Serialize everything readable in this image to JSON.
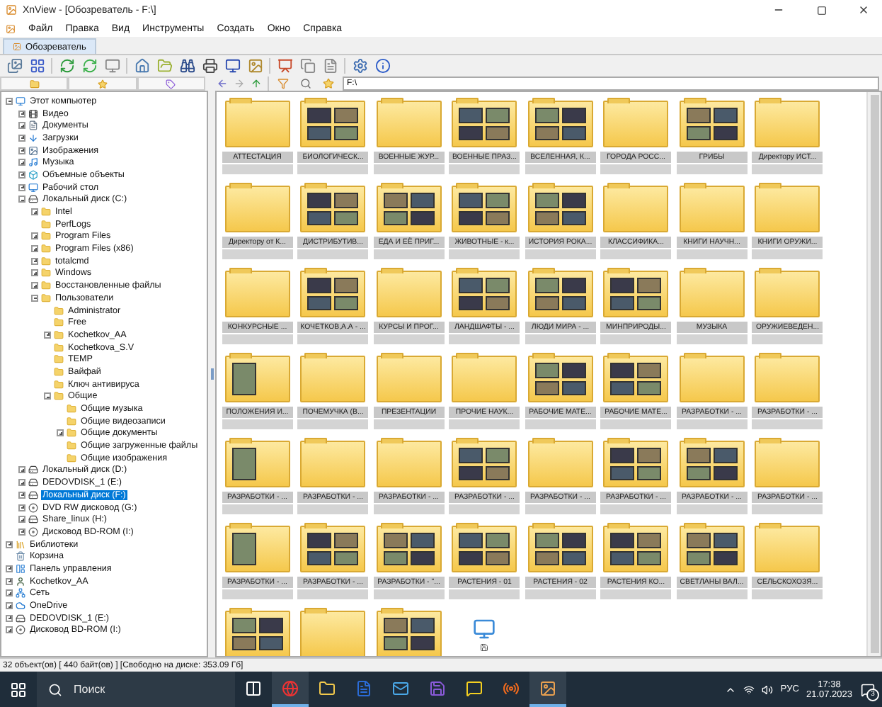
{
  "window": {
    "title": "XnView - [Обозреватель - F:\\]"
  },
  "menu": [
    "Файл",
    "Правка",
    "Вид",
    "Инструменты",
    "Создать",
    "Окно",
    "Справка"
  ],
  "tabs": [
    {
      "label": "Обозреватель",
      "selected": true
    }
  ],
  "path": {
    "value": "F:\\"
  },
  "tree": [
    {
      "label": "Этот компьютер",
      "kind": "computer",
      "expanded": true,
      "selected": false,
      "children": [
        {
          "label": "Видео",
          "kind": "video",
          "expanded": false,
          "selected": false
        },
        {
          "label": "Документы",
          "kind": "documents",
          "expanded": false,
          "selected": false
        },
        {
          "label": "Загрузки",
          "kind": "downloads",
          "expanded": false,
          "selected": false
        },
        {
          "label": "Изображения",
          "kind": "pictures",
          "expanded": false,
          "selected": false
        },
        {
          "label": "Музыка",
          "kind": "music",
          "expanded": false,
          "selected": false
        },
        {
          "label": "Объемные объекты",
          "kind": "objects",
          "expanded": false,
          "selected": false
        },
        {
          "label": "Рабочий стол",
          "kind": "desktop",
          "expanded": false,
          "selected": false
        },
        {
          "label": "Локальный диск (C:)",
          "kind": "drive",
          "expanded": true,
          "selected": false,
          "children": [
            {
              "label": "Intel",
              "kind": "folder",
              "expanded": false,
              "selected": false
            },
            {
              "label": "PerfLogs",
              "kind": "folder",
              "selected": false
            },
            {
              "label": "Program Files",
              "kind": "folder",
              "expanded": false,
              "selected": false
            },
            {
              "label": "Program Files (x86)",
              "kind": "folder",
              "expanded": false,
              "selected": false
            },
            {
              "label": "totalcmd",
              "kind": "folder",
              "expanded": false,
              "selected": false
            },
            {
              "label": "Windows",
              "kind": "folder",
              "expanded": false,
              "selected": false
            },
            {
              "label": "Восстановленные файлы",
              "kind": "folder",
              "expanded": false,
              "selected": false
            },
            {
              "label": "Пользователи",
              "kind": "folder",
              "expanded": true,
              "selected": false,
              "children": [
                {
                  "label": "Administrator",
                  "kind": "folder",
                  "selected": false
                },
                {
                  "label": "Free",
                  "kind": "folder",
                  "selected": false
                },
                {
                  "label": "Kochetkov_AA",
                  "kind": "folder",
                  "expanded": false,
                  "selected": false
                },
                {
                  "label": "Kochetkova_S.V",
                  "kind": "folder",
                  "selected": false
                },
                {
                  "label": "TEMP",
                  "kind": "folder",
                  "selected": false
                },
                {
                  "label": "Вайфай",
                  "kind": "folder",
                  "selected": false
                },
                {
                  "label": "Ключ антивируса",
                  "kind": "folder",
                  "selected": false
                },
                {
                  "label": "Общие",
                  "kind": "folder",
                  "expanded": true,
                  "selected": false,
                  "children": [
                    {
                      "label": "Общие музыка",
                      "kind": "folder",
                      "selected": false
                    },
                    {
                      "label": "Общие видеозаписи",
                      "kind": "folder",
                      "selected": false
                    },
                    {
                      "label": "Общие документы",
                      "kind": "folder",
                      "expanded": false,
                      "selected": false
                    },
                    {
                      "label": "Общие загруженные файлы",
                      "kind": "folder",
                      "selected": false
                    },
                    {
                      "label": "Общие изображения",
                      "kind": "folder",
                      "selected": false
                    }
                  ]
                }
              ]
            }
          ]
        },
        {
          "label": "Локальный диск (D:)",
          "kind": "drive",
          "expanded": false,
          "selected": false
        },
        {
          "label": "DEDOVDISK_1 (E:)",
          "kind": "drive",
          "expanded": false,
          "selected": false
        },
        {
          "label": "Локальный диск (F:)",
          "kind": "drive",
          "expanded": false,
          "selected": true
        },
        {
          "label": "DVD RW дисковод (G:)",
          "kind": "disc",
          "expanded": false,
          "selected": false
        },
        {
          "label": "Share_linux (H:)",
          "kind": "drive",
          "expanded": false,
          "selected": false
        },
        {
          "label": "Дисковод BD-ROM (I:)",
          "kind": "disc",
          "expanded": false,
          "selected": false
        }
      ]
    },
    {
      "label": "Библиотеки",
      "kind": "library",
      "expanded": false,
      "selected": false
    },
    {
      "label": "Корзина",
      "kind": "trash",
      "selected": false
    },
    {
      "label": "Панель управления",
      "kind": "panel",
      "expanded": false,
      "selected": false
    },
    {
      "label": "Kochetkov_AA",
      "kind": "user",
      "expanded": false,
      "selected": false
    },
    {
      "label": "Сеть",
      "kind": "network",
      "expanded": false,
      "selected": false
    },
    {
      "label": "OneDrive",
      "kind": "cloud",
      "expanded": false,
      "selected": false
    },
    {
      "label": "DEDOVDISK_1 (E:)",
      "kind": "drive",
      "expanded": false,
      "selected": false
    },
    {
      "label": "Дисковод BD-ROM (I:)",
      "kind": "disc",
      "expanded": false,
      "selected": false
    }
  ],
  "thumbnails": [
    {
      "label": "АТТЕСТАЦИЯ",
      "kind": "plain"
    },
    {
      "label": "БИОЛОГИЧЕСК...",
      "kind": "quad"
    },
    {
      "label": "ВОЕННЫЕ ЖУР...",
      "kind": "plain"
    },
    {
      "label": "ВОЕННЫЕ ПРАЗ...",
      "kind": "quad"
    },
    {
      "label": "ВСЕЛЕННАЯ, К...",
      "kind": "quad"
    },
    {
      "label": "ГОРОДА РОСС...",
      "kind": "plain"
    },
    {
      "label": "ГРИБЫ",
      "kind": "quad"
    },
    {
      "label": "Директору ИСТ...",
      "kind": "plain"
    },
    {
      "label": "Директору от К...",
      "kind": "plain"
    },
    {
      "label": "ДИСТРИБУТИВ...",
      "kind": "quad"
    },
    {
      "label": "ЕДА И ЕЁ ПРИГ...",
      "kind": "quad"
    },
    {
      "label": "ЖИВОТНЫЕ - к...",
      "kind": "quad"
    },
    {
      "label": "ИСТОРИЯ РОКА...",
      "kind": "quad"
    },
    {
      "label": "КЛАССИФИКА...",
      "kind": "plain"
    },
    {
      "label": "КНИГИ НАУЧН...",
      "kind": "plain"
    },
    {
      "label": "КНИГИ ОРУЖИ...",
      "kind": "plain"
    },
    {
      "label": "КОНКУРСНЫЕ ...",
      "kind": "plain"
    },
    {
      "label": "КОЧЕТКОВ,А.А - ...",
      "kind": "quad"
    },
    {
      "label": "КУРСЫ И ПРОГ...",
      "kind": "plain"
    },
    {
      "label": "ЛАНДШАФТЫ - ...",
      "kind": "quad"
    },
    {
      "label": "ЛЮДИ МИРА - ...",
      "kind": "quad"
    },
    {
      "label": "МИНПРИРОДЫ...",
      "kind": "quad"
    },
    {
      "label": "МУЗЫКА",
      "kind": "plain"
    },
    {
      "label": "ОРУЖИЕВЕДЕН...",
      "kind": "plain"
    },
    {
      "label": "ПОЛОЖЕНИЯ И...",
      "kind": "single"
    },
    {
      "label": "ПОЧЕМУЧКА (В...",
      "kind": "plain"
    },
    {
      "label": "ПРЕЗЕНТАЦИИ",
      "kind": "plain"
    },
    {
      "label": "ПРОЧИЕ НАУК...",
      "kind": "plain"
    },
    {
      "label": "РАБОЧИЕ МАТЕ...",
      "kind": "quad"
    },
    {
      "label": "РАБОЧИЕ МАТЕ...",
      "kind": "quad"
    },
    {
      "label": "РАЗРАБОТКИ - ...",
      "kind": "plain"
    },
    {
      "label": "РАЗРАБОТКИ - ...",
      "kind": "plain"
    },
    {
      "label": "РАЗРАБОТКИ - ...",
      "kind": "single"
    },
    {
      "label": "РАЗРАБОТКИ - ...",
      "kind": "plain"
    },
    {
      "label": "РАЗРАБОТКИ - ...",
      "kind": "plain"
    },
    {
      "label": "РАЗРАБОТКИ - ...",
      "kind": "quad"
    },
    {
      "label": "РАЗРАБОТКИ - ...",
      "kind": "plain"
    },
    {
      "label": "РАЗРАБОТКИ - ...",
      "kind": "quad"
    },
    {
      "label": "РАЗРАБОТКИ - ...",
      "kind": "quad"
    },
    {
      "label": "РАЗРАБОТКИ - ...",
      "kind": "plain"
    },
    {
      "label": "РАЗРАБОТКИ - ...",
      "kind": "single"
    },
    {
      "label": "РАЗРАБОТКИ - ...",
      "kind": "quad"
    },
    {
      "label": "РАЗРАБОТКИ - \"...",
      "kind": "quad"
    },
    {
      "label": "РАСТЕНИЯ - 01",
      "kind": "quad"
    },
    {
      "label": "РАСТЕНИЯ - 02",
      "kind": "quad"
    },
    {
      "label": "РАСТЕНИЯ КО...",
      "kind": "quad"
    },
    {
      "label": "СВЕТЛАНЫ ВАЛ...",
      "kind": "quad"
    },
    {
      "label": "СЕЛЬСКОХОЗЯ...",
      "kind": "plain"
    },
    {
      "kind": "quad"
    },
    {
      "kind": "plain"
    },
    {
      "kind": "quad"
    },
    {
      "kind": "computer"
    }
  ],
  "status_bar": "32 объект(ов) [ 440 байт(ов) ] [Свободно на диске: 353.09 Гб]",
  "taskbar": {
    "search": {
      "placeholder": "Поиск"
    },
    "apps": [
      {
        "kind": "taskview",
        "active": false
      },
      {
        "kind": "browser",
        "active": true
      },
      {
        "kind": "files",
        "active": false
      },
      {
        "kind": "word",
        "active": false
      },
      {
        "kind": "mail",
        "active": false
      },
      {
        "kind": "disk",
        "active": false
      },
      {
        "kind": "notes",
        "active": false
      },
      {
        "kind": "radio",
        "active": false
      },
      {
        "kind": "viewer",
        "active": true
      }
    ],
    "language": "РУС",
    "time": "17:38",
    "date": "21.07.2023",
    "notifications": "3"
  }
}
